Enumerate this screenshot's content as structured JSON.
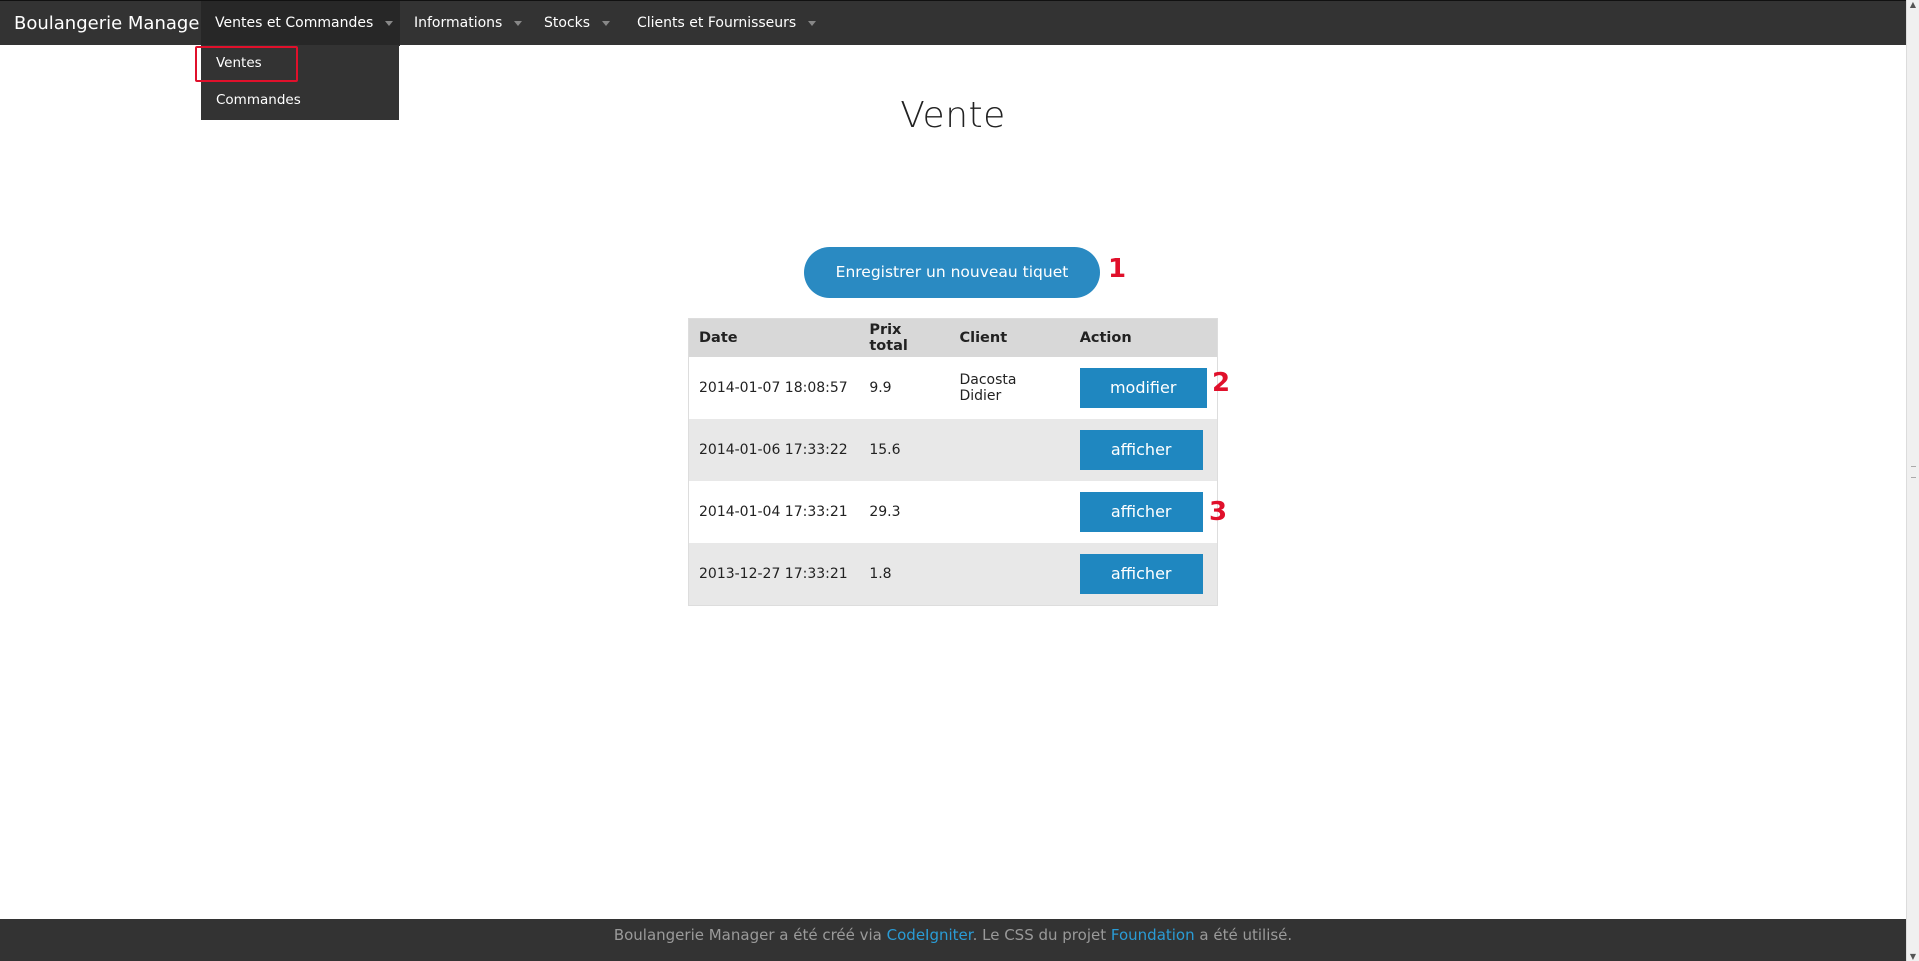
{
  "app": {
    "brand": "Boulangerie Manager"
  },
  "nav": {
    "items": [
      {
        "label": "Ventes et Commandes"
      },
      {
        "label": "Informations"
      },
      {
        "label": "Stocks"
      },
      {
        "label": "Clients et Fournisseurs"
      }
    ],
    "dropdown": [
      {
        "label": "Ventes"
      },
      {
        "label": "Commandes"
      }
    ]
  },
  "page": {
    "title": "Vente",
    "new_button": "Enregistrer un nouveau tiquet"
  },
  "markers": [
    "1",
    "2",
    "3"
  ],
  "table": {
    "headers": [
      "Date",
      "Prix total",
      "Client",
      "Action"
    ],
    "rows": [
      {
        "date": "2014-01-07 18:08:57",
        "total": "9.9",
        "client": "Dacosta Didier",
        "action": "modifier"
      },
      {
        "date": "2014-01-06 17:33:22",
        "total": "15.6",
        "client": "",
        "action": "afficher"
      },
      {
        "date": "2014-01-04 17:33:21",
        "total": "29.3",
        "client": "",
        "action": "afficher"
      },
      {
        "date": "2013-12-27 17:33:21",
        "total": "1.8",
        "client": "",
        "action": "afficher"
      }
    ]
  },
  "footer": {
    "line1_prefix": "Boulangerie Manager a été créé via",
    "line1_link1": "CodeIgniter",
    "line1_middle": ". Le CSS du projet",
    "line1_link2": "Foundation",
    "line1_suffix": "a été utilisé."
  },
  "colors": {
    "accent": "#2a8ac2",
    "navbar": "#333333",
    "highlight": "#e0102b"
  }
}
